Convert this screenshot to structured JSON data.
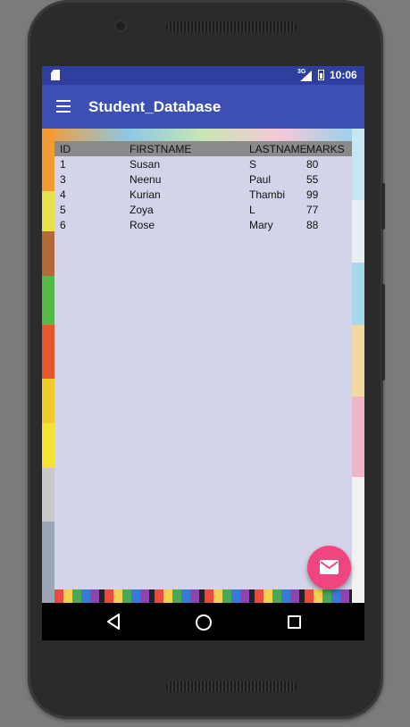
{
  "status_bar": {
    "network": "3G",
    "time": "10:06"
  },
  "app_bar": {
    "title": "Student_Database",
    "menu_icon": "hamburger-menu-icon"
  },
  "table": {
    "headers": [
      "ID",
      "FIRSTNAME",
      "LASTNAME",
      "MARKS"
    ],
    "rows": [
      {
        "id": "1",
        "firstname": "Susan",
        "lastname": "S",
        "marks": "80"
      },
      {
        "id": "3",
        "firstname": "Neenu",
        "lastname": "Paul",
        "marks": "55"
      },
      {
        "id": "4",
        "firstname": "Kurian",
        "lastname": "Thambi",
        "marks": "99"
      },
      {
        "id": "5",
        "firstname": "Zoya",
        "lastname": "L",
        "marks": "77"
      },
      {
        "id": "6",
        "firstname": "Rose",
        "lastname": "Mary",
        "marks": "88"
      }
    ]
  },
  "fab": {
    "icon": "email-icon",
    "color": "#f04580"
  },
  "nav_bar": {
    "back_icon": "back-triangle-icon",
    "home_icon": "home-circle-icon",
    "recent_icon": "recent-apps-square-icon"
  },
  "colors": {
    "primary": "#3e4fb4",
    "primary_dark": "#2f3e9f",
    "panel": "#d3d3e9",
    "table_header": "#8a8a8a"
  }
}
